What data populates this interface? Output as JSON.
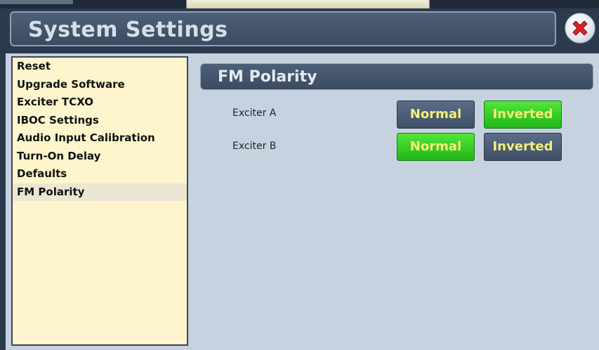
{
  "window": {
    "title": "System Settings"
  },
  "sidebar": {
    "items": [
      {
        "label": "Reset"
      },
      {
        "label": "Upgrade Software"
      },
      {
        "label": "Exciter TCXO"
      },
      {
        "label": "IBOC Settings"
      },
      {
        "label": "Audio Input Calibration"
      },
      {
        "label": "Turn-On Delay"
      },
      {
        "label": "Defaults"
      },
      {
        "label": "FM Polarity"
      }
    ],
    "selected": "FM Polarity"
  },
  "section": {
    "title": "FM Polarity"
  },
  "rows": [
    {
      "label": "Exciter A",
      "normal_label": "Normal",
      "inverted_label": "Inverted",
      "selected": "Inverted"
    },
    {
      "label": "Exciter B",
      "normal_label": "Normal",
      "inverted_label": "Inverted",
      "selected": "Normal"
    }
  ],
  "colors": {
    "selected_button": "#2fc41f",
    "unselected_button": "#4b5d76",
    "button_text": "#f5f07a",
    "sidebar_bg": "#fff5cc",
    "close_icon": "#d8252a"
  },
  "icons": {
    "close": "close-icon"
  }
}
